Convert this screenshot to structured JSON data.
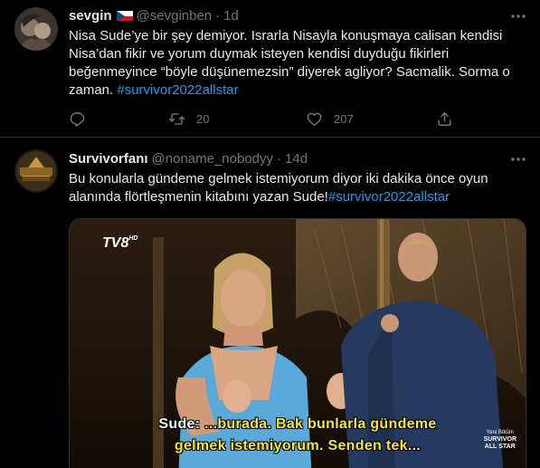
{
  "tweets": [
    {
      "display_name": "sevgin",
      "handle": "@sevginben",
      "separator": "·",
      "time": "1d",
      "text": "Nisa Sude’ye bir şey demiyor. Israrla Nisayla konuşmaya calisan kendisi Nisa’dan fikir ve yorum duymak isteyen kendisi duyduğu fikirleri beğenmeyince “böyle düşünemezsin” diyerek agliyor? Sacmalik. Sorma o zaman. ",
      "hashtag": "#survivor2022allstar",
      "reply_count": "",
      "retweet_count": "20",
      "like_count": "207",
      "icons": [
        "more-icon",
        "reply-icon",
        "retweet-icon",
        "like-icon",
        "share-icon"
      ]
    },
    {
      "display_name": "Survivorfanı",
      "handle": "@noname_nobodyy",
      "separator": "·",
      "time": "14d",
      "text": "Bu konularla gündeme gelmek istemiyorum diyor iki dakika önce oyun alanında flörtleşmenin kitabını yazan Sude!",
      "hashtag": "#survivor2022allstar",
      "media": {
        "channel_logo": "TV8",
        "channel_logo_suffix": "HD",
        "subtitle_line1_speaker": "Sude:",
        "subtitle_line1": " ...burada. Bak bunlarla gündeme",
        "subtitle_line2": "gelmek istemiyorum. Senden tek...",
        "watermark_top": "Yeni Bölüm",
        "watermark_main": "SURVIVOR",
        "watermark_sub": "ALL STAR"
      }
    }
  ],
  "colors": {
    "background": "#000000",
    "text": "#e7e9ea",
    "muted": "#71767b",
    "link": "#1d9bf0",
    "divider": "#2f3336",
    "subtitle": "#f5e83a"
  }
}
